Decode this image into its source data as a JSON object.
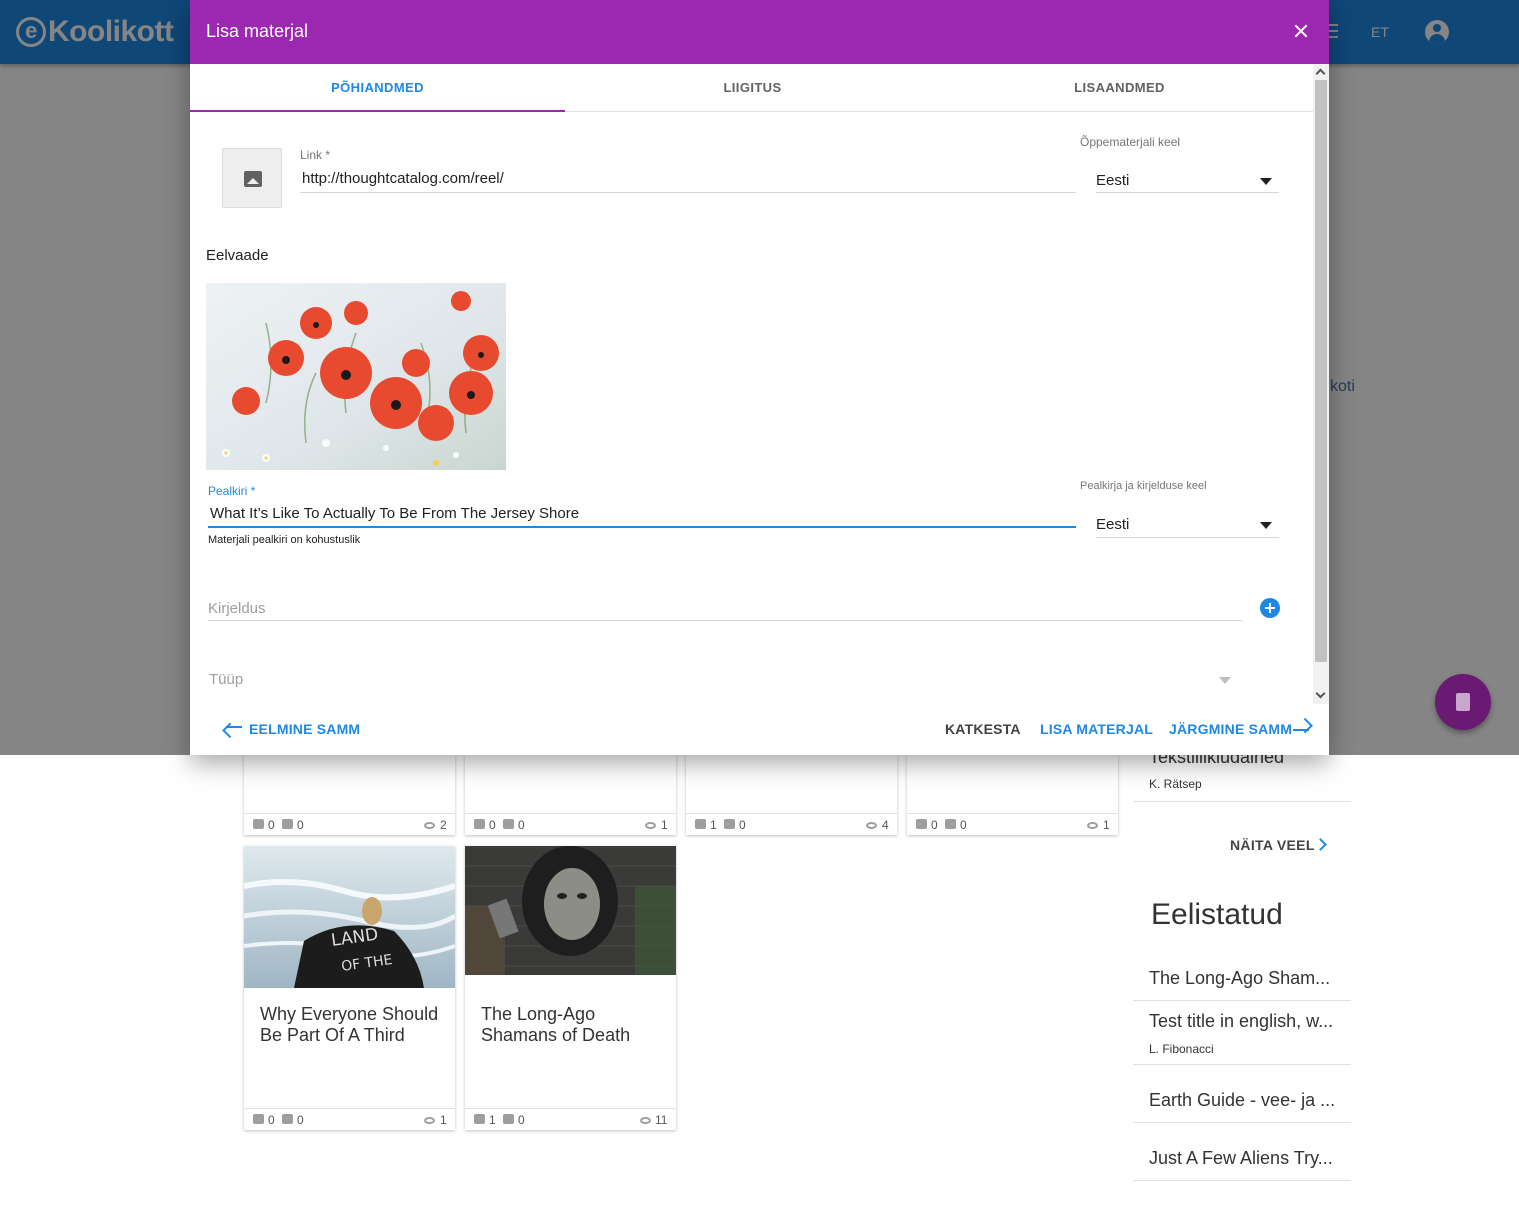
{
  "app": {
    "logo_text": "Koolikott",
    "language": "ET"
  },
  "background": {
    "sidebar_link_fragment": "koti",
    "cards_row1": [
      {
        "likes": "0",
        "dislikes": "0",
        "views": "2"
      },
      {
        "likes": "0",
        "dislikes": "0",
        "views": "1"
      },
      {
        "likes": "1",
        "dislikes": "0",
        "views": "4"
      },
      {
        "likes": "0",
        "dislikes": "0",
        "views": "1"
      }
    ],
    "cards_row2": [
      {
        "title": "Why Everyone Should Be Part Of A Third",
        "likes": "0",
        "dislikes": "0",
        "views": "1"
      },
      {
        "title": "The Long-Ago Shamans of Death",
        "likes": "1",
        "dislikes": "0",
        "views": "11"
      }
    ],
    "sidebar_recent": {
      "title": "Tekstiilikiudained",
      "author": "K. Rätsep"
    },
    "show_more": "NÄITA VEEL",
    "featured_heading": "Eelistatud",
    "featured_items": [
      {
        "title": "The Long-Ago Sham...",
        "author": ""
      },
      {
        "title": "Test title in english, w...",
        "author": "L. Fibonacci"
      },
      {
        "title": "Earth Guide - vee- ja ...",
        "author": ""
      },
      {
        "title": "Just A Few Aliens Try...",
        "author": ""
      }
    ]
  },
  "dialog": {
    "title": "Lisa materjal",
    "tabs": [
      {
        "label": "PÕHIANDMED",
        "active": true
      },
      {
        "label": "LIIGITUS",
        "active": false
      },
      {
        "label": "LISAANDMED",
        "active": false
      }
    ],
    "link": {
      "label": "Link *",
      "value": "http://thoughtcatalog.com/reel/"
    },
    "material_language": {
      "label": "Õppematerjali keel",
      "value": "Eesti"
    },
    "preview_label": "Eelvaade",
    "title_field": {
      "label": "Pealkiri *",
      "value": "What It’s Like To Actually To Be From The Jersey Shore",
      "hint": "Materjali pealkiri on kohustuslik"
    },
    "title_language": {
      "label": "Pealkirja ja kirjelduse keel",
      "value": "Eesti"
    },
    "description": {
      "placeholder": "Kirjeldus"
    },
    "type": {
      "placeholder": "Tüüp"
    },
    "actions": {
      "previous": "EELMINE SAMM",
      "cancel": "KATKESTA",
      "add": "LISA MATERJAL",
      "next": "JÄRGMINE SAMM"
    }
  },
  "colors": {
    "header_purple": "#9c27b0",
    "topbar_blue": "#1e88e5",
    "accent_blue": "#1e88e5",
    "fab_purple": "#6a1a73"
  }
}
